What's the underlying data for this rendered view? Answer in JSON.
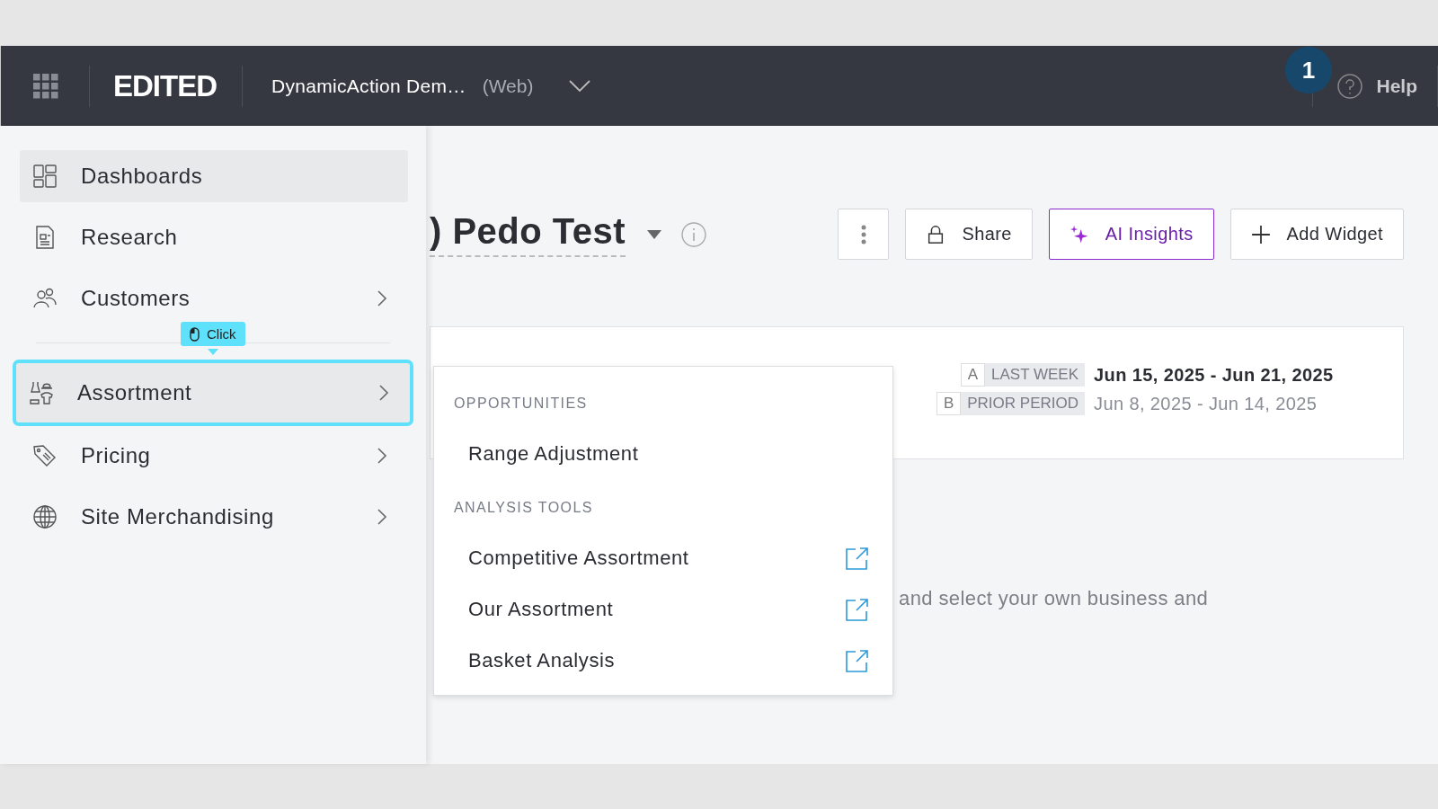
{
  "header": {
    "logo": "EDITED",
    "workspace": "DynamicAction Dem…",
    "platform": "(Web)",
    "help": "Help",
    "step_badge": "1"
  },
  "sidebar": {
    "items": [
      {
        "kind": "dashboards",
        "label": "Dashboards",
        "selected": true,
        "highlighted": false,
        "has_submenu": false
      },
      {
        "kind": "research",
        "label": "Research",
        "selected": false,
        "highlighted": false,
        "has_submenu": false
      },
      {
        "kind": "customers",
        "label": "Customers",
        "selected": false,
        "highlighted": false,
        "has_submenu": true
      },
      {
        "kind": "assortment",
        "label": "Assortment",
        "selected": true,
        "highlighted": true,
        "has_submenu": true
      },
      {
        "kind": "pricing",
        "label": "Pricing",
        "selected": false,
        "highlighted": false,
        "has_submenu": true
      },
      {
        "kind": "globe",
        "label": "Site Merchandising",
        "selected": false,
        "highlighted": false,
        "has_submenu": true
      }
    ],
    "tooltip": {
      "label": "Click"
    }
  },
  "toolbar": {
    "title": ") Pedo Test",
    "buttons": [
      {
        "kind": "more"
      },
      {
        "kind": "share",
        "label": "Share"
      },
      {
        "kind": "ai",
        "label": "AI Insights"
      },
      {
        "kind": "add",
        "label": "Add Widget"
      }
    ]
  },
  "date_card": {
    "periods": [
      {
        "letter": "A",
        "label": "LAST WEEK",
        "range": "Jun 15, 2025 - Jun 21, 2025",
        "primary": true
      },
      {
        "letter": "B",
        "label": "PRIOR PERIOD",
        "range": "Jun 8, 2025 - Jun 14, 2025",
        "primary": false
      }
    ]
  },
  "description": "and select your own business and",
  "dropdown": {
    "sections": [
      {
        "heading": "OPPORTUNITIES",
        "items": [
          {
            "label": "Range Adjustment",
            "external": false
          }
        ]
      },
      {
        "heading": "ANALYSIS TOOLS",
        "items": [
          {
            "label": "Competitive Assortment",
            "external": true
          },
          {
            "label": "Our Assortment",
            "external": true
          },
          {
            "label": "Basket Analysis",
            "external": true
          }
        ]
      }
    ]
  }
}
